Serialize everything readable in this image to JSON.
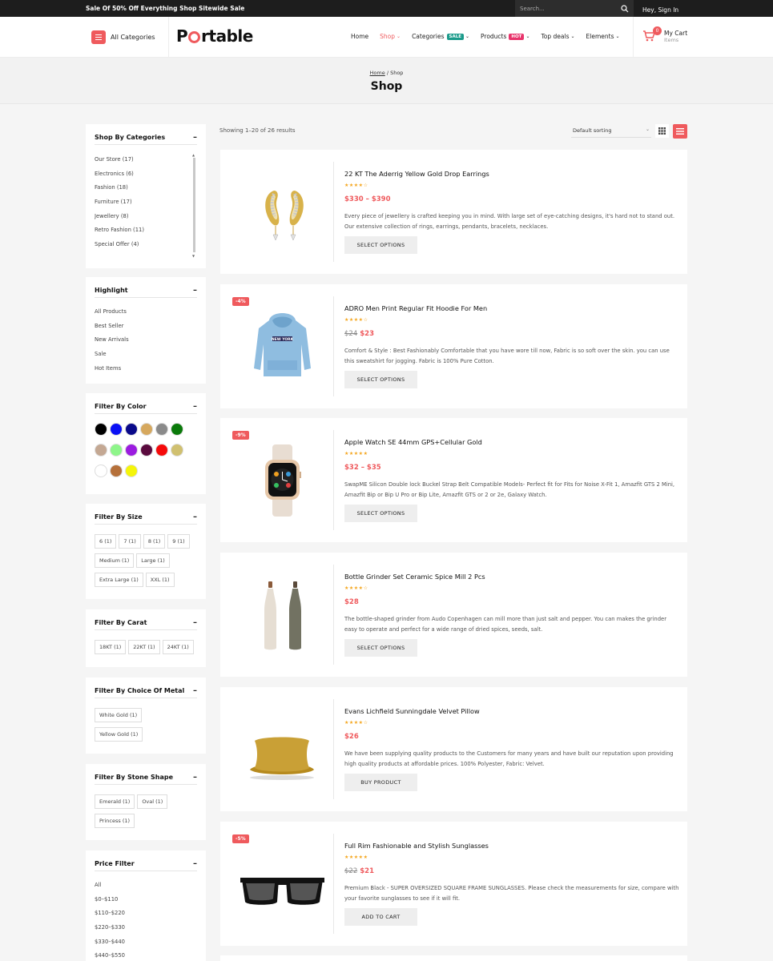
{
  "topbar": {
    "promo": "Sale Of 50% Off Everything Shop Sitewide Sale",
    "search_placeholder": "Search...",
    "signin": "Hey, Sign In"
  },
  "header": {
    "all_categories": "All Categories",
    "logo_pre": "P",
    "logo_post": "rtable",
    "nav": [
      {
        "label": "Home"
      },
      {
        "label": "Shop"
      },
      {
        "label": "Categories",
        "badge": "SALE"
      },
      {
        "label": "Products",
        "badge": "HOT"
      },
      {
        "label": "Top deals"
      },
      {
        "label": "Elements"
      }
    ],
    "cart": {
      "count": "0",
      "title": "My Cart",
      "sub": "Items"
    }
  },
  "colors": {
    "accent": "#ef5a5d",
    "sale_badge": "#1a9a8a",
    "hot_badge": "#e8336b",
    "star": "#f4a51c"
  },
  "pagetitle": {
    "crumb_home": "Home",
    "crumb_sep": " / ",
    "crumb_current": "Shop",
    "title": "Shop"
  },
  "sidebar": {
    "categories": {
      "title": "Shop By Categories",
      "items": [
        "Our Store (17)",
        "Electronics (6)",
        "Fashion (18)",
        "Furniture (17)",
        "Jewellery (8)",
        "Retro Fashion (11)",
        "Special Offer (4)"
      ]
    },
    "highlight": {
      "title": "Highlight",
      "items": [
        "All Products",
        "Best Seller",
        "New Arrivals",
        "Sale",
        "Hot Items"
      ]
    },
    "color": {
      "title": "Filter By Color",
      "swatches": [
        "#000000",
        "#0a10f5",
        "#0a0a8a",
        "#d6a85e",
        "#8a8a8a",
        "#0a7a0a",
        "#c4a893",
        "#8ef58a",
        "#9b1ce0",
        "#5a0a3e",
        "#f50a0a",
        "#d0c070",
        "#ffffff",
        "#b5703a",
        "#f5f50a"
      ]
    },
    "size": {
      "title": "Filter By Size",
      "chips": [
        "6 (1)",
        "7 (1)",
        "8 (1)",
        "9 (1)",
        "Medium (1)",
        "Large (1)",
        "Extra Large (1)",
        "XXL (1)"
      ]
    },
    "carat": {
      "title": "Filter By Carat",
      "chips": [
        "18KT (1)",
        "22KT (1)",
        "24KT (1)"
      ]
    },
    "metal": {
      "title": "Filter By Choice Of Metal",
      "chips": [
        "White Gold (1)",
        "Yellow Gold (1)"
      ]
    },
    "stone": {
      "title": "Filter By Stone Shape",
      "chips": [
        "Emerald (1)",
        "Oval (1)",
        "Princess (1)"
      ]
    },
    "price": {
      "title": "Price Filter",
      "items": [
        "All",
        "$0–$110",
        "$110–$220",
        "$220–$330",
        "$330–$440",
        "$440–$550"
      ]
    }
  },
  "main": {
    "result_count": "Showing 1–20 of 26 results",
    "sorting": "Default sorting",
    "products": [
      {
        "name": "22 KT The Aderrig Yellow Gold Drop Earrings",
        "rating": 4,
        "old_price": "",
        "price": "$330 – $390",
        "discount": "",
        "desc": "Every piece of jewellery is crafted keeping you in mind. With large set of eye-catching designs, it's hard not to stand out. Our extensive collection of rings, earrings, pendants, bracelets, necklaces.",
        "button": "SELECT OPTIONS"
      },
      {
        "name": "ADRO Men Print Regular Fit Hoodie For Men",
        "rating": 4,
        "old_price": "$24",
        "price": "$23",
        "discount": "-4%",
        "desc": "Comfort & Style : Best Fashionably Comfortable that you have wore till now, Fabric is so soft over the skin. you can use this sweatshirt for jogging. Fabric is 100% Pure Cotton.",
        "button": "SELECT OPTIONS",
        "print": "NEW YORK"
      },
      {
        "name": "Apple Watch SE 44mm GPS+Cellular Gold",
        "rating": 5,
        "old_price": "",
        "price": "$32 – $35",
        "discount": "-9%",
        "desc": "SwapME Silicon Double lock Buckel Strap Belt Compatible Models- Perfect fit for Fits for Noise X-Fit 1, Amazfit GTS 2 Mini, Amazfit Bip or Bip U Pro or Bip Lite, Amazfit GTS or 2 or 2e, Galaxy Watch.",
        "button": "SELECT OPTIONS"
      },
      {
        "name": "Bottle Grinder Set Ceramic Spice Mill 2 Pcs",
        "rating": 4,
        "old_price": "",
        "price": "$28",
        "discount": "",
        "desc": "The bottle-shaped grinder from Audo Copenhagen can mill more than just salt and pepper. You can makes the grinder easy to operate and perfect for a wide range of dried spices, seeds, salt.",
        "button": "SELECT OPTIONS"
      },
      {
        "name": "Evans Lichfield Sunningdale Velvet Pillow",
        "rating": 4,
        "old_price": "",
        "price": "$26",
        "discount": "",
        "desc": "We have been supplying quality products to the Customers for many years and have built our reputation upon providing high quality products at affordable prices. 100% Polyester, Fabric: Velvet.",
        "button": "BUY PRODUCT"
      },
      {
        "name": "Full Rim Fashionable and Stylish Sunglasses",
        "rating": 5,
        "old_price": "$22",
        "price": "$21",
        "discount": "-5%",
        "desc": "Premium Black - SUPER OVERSIZED SQUARE FRAME SUNGLASSES. Please check the measurements for size, compare with your favorite sunglasses to see if it will fit.",
        "button": "ADD TO CART"
      }
    ]
  }
}
